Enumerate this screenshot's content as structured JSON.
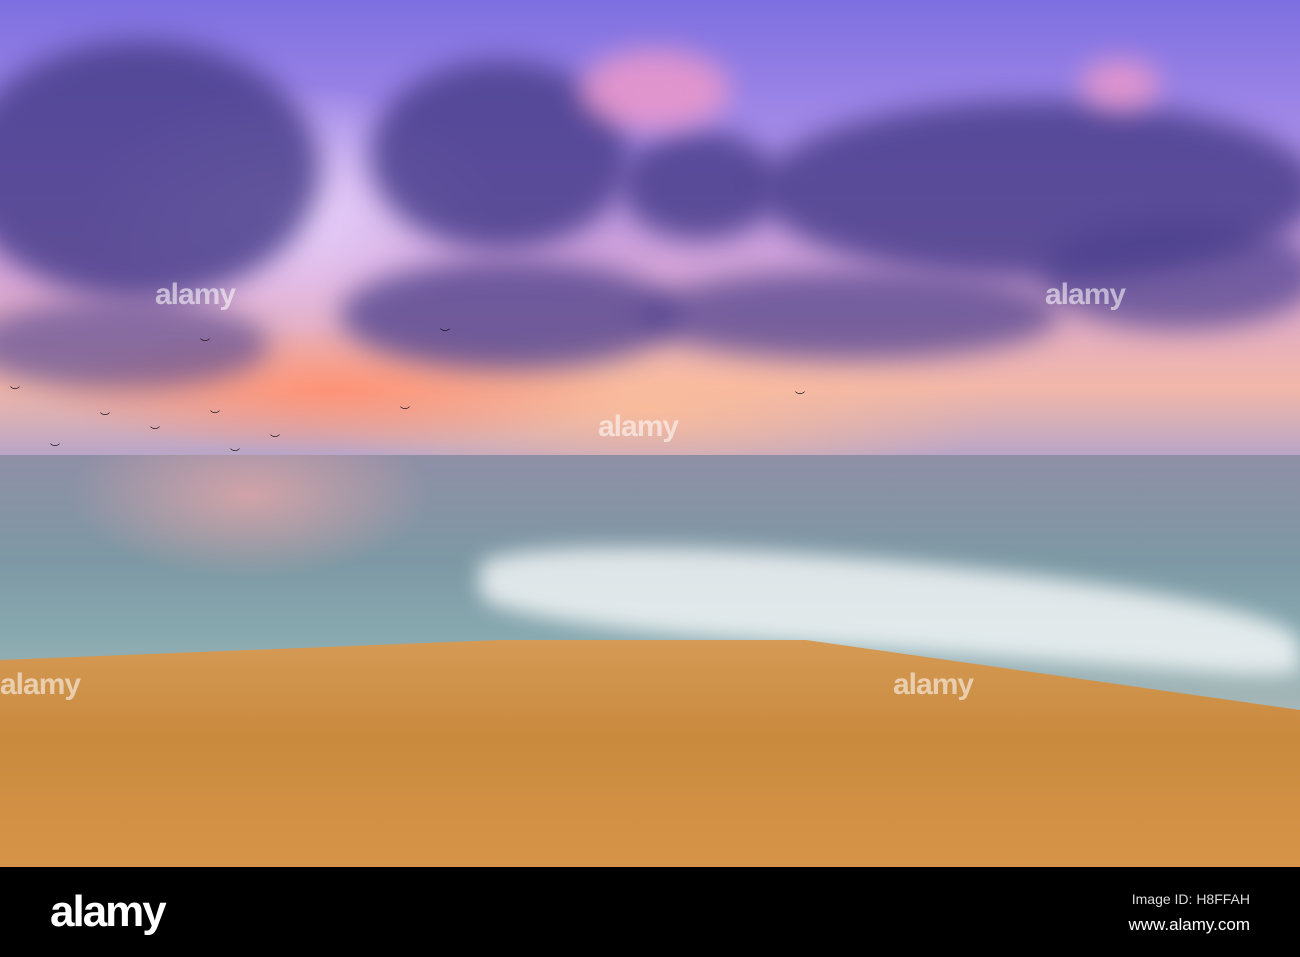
{
  "photo": {
    "description_alt": "Sunset beach"
  },
  "watermark": {
    "text": "alamy"
  },
  "footer": {
    "logo": "alamy",
    "image_id": "Image ID: H8FFAH",
    "website": "www.alamy.com"
  }
}
